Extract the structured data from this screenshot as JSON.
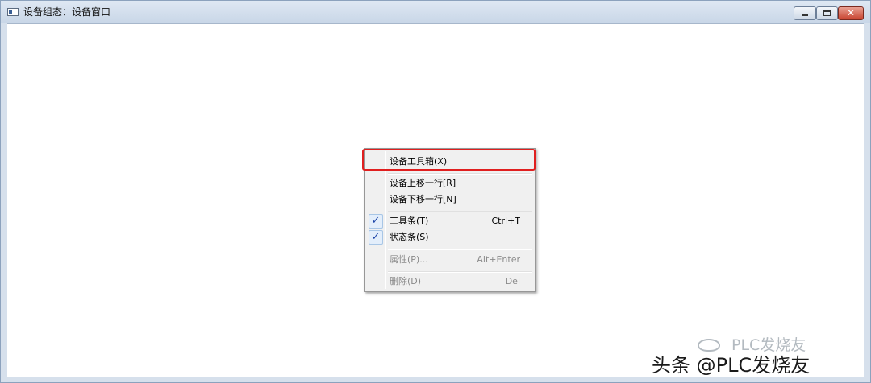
{
  "window": {
    "title": "设备组态：设备窗口",
    "close_glyph": "✕"
  },
  "context_menu": {
    "items": [
      {
        "label": "设备工具箱(X)",
        "shortcut": "",
        "checked": false,
        "disabled": false,
        "highlighted": true
      },
      {
        "label": "设备上移一行[R]",
        "shortcut": "",
        "checked": false,
        "disabled": false
      },
      {
        "label": "设备下移一行[N]",
        "shortcut": "",
        "checked": false,
        "disabled": false
      },
      {
        "label": "工具条(T)",
        "shortcut": "Ctrl+T",
        "checked": true,
        "disabled": false
      },
      {
        "label": "状态条(S)",
        "shortcut": "",
        "checked": true,
        "disabled": false
      },
      {
        "label": "属性(P)...",
        "shortcut": "Alt+Enter",
        "checked": false,
        "disabled": true
      },
      {
        "label": "删除(D)",
        "shortcut": "Del",
        "checked": false,
        "disabled": true
      }
    ],
    "check_glyph": "✓",
    "highlight_color": "#e01f1f"
  },
  "watermark": {
    "line1": "PLC发烧友",
    "line2": "头条 @PLC发烧友"
  }
}
